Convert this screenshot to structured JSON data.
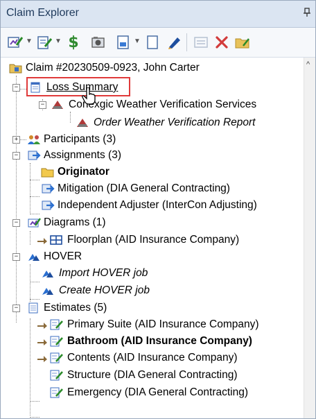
{
  "panel": {
    "title": "Claim Explorer",
    "pin_icon": "pin-icon"
  },
  "toolbar": {
    "icons": [
      "edit-claim-icon",
      "edit-doc-icon",
      "payment-icon",
      "photos-icon",
      "new-doc-icon",
      "new-page-icon",
      "sketch-icon",
      "list-disabled-icon",
      "delete-icon",
      "folder-icon"
    ],
    "colors": {
      "accent": "#1e395b",
      "delete": "#d23b3b",
      "payment": "#2f8a2f"
    }
  },
  "tree": {
    "claim": {
      "label": "Claim #20230509-0923, John Carter"
    },
    "loss_summary": {
      "label": "Loss Summary"
    },
    "weather_service": {
      "label": "Conexgic Weather Verification Services"
    },
    "order_weather": {
      "label": "Order Weather Verification Report"
    },
    "participants": {
      "label": "Participants (3)"
    },
    "assignments": {
      "label": "Assignments (3)"
    },
    "originator": {
      "label": "Originator"
    },
    "mitigation": {
      "label": "Mitigation (DIA General Contracting)"
    },
    "independent_adjuster": {
      "label": "Independent Adjuster (InterCon Adjusting)"
    },
    "diagrams": {
      "label": "Diagrams (1)"
    },
    "floorplan": {
      "label": "Floorplan (AID Insurance Company)"
    },
    "hover": {
      "label": "HOVER"
    },
    "import_hover": {
      "label": "Import HOVER job"
    },
    "create_hover": {
      "label": "Create HOVER job"
    },
    "estimates": {
      "label": "Estimates (5)"
    },
    "primary_suite": {
      "label": "Primary Suite (AID Insurance Company)"
    },
    "bathroom": {
      "label": "Bathroom (AID Insurance Company)"
    },
    "contents": {
      "label": "Contents (AID Insurance Company)"
    },
    "structure": {
      "label": "Structure (DIA General Contracting)"
    },
    "emergency": {
      "label": "Emergency (DIA General Contracting)"
    }
  }
}
